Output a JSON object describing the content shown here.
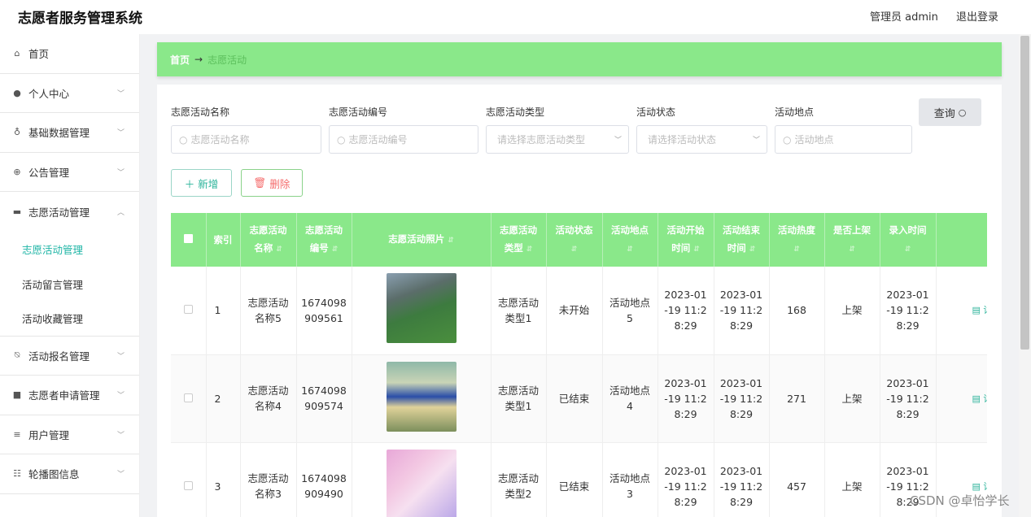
{
  "app": {
    "title": "志愿者服务管理系统",
    "user_label": "管理员 admin",
    "logout": "退出登录"
  },
  "sidebar": {
    "items": [
      {
        "label": "首页",
        "icon": "home-icon"
      },
      {
        "label": "个人中心",
        "icon": "user-icon"
      },
      {
        "label": "基础数据管理",
        "icon": "mic-icon"
      },
      {
        "label": "公告管理",
        "icon": "compass-icon"
      },
      {
        "label": "志愿活动管理",
        "icon": "chat-icon"
      },
      {
        "label": "活动报名管理",
        "icon": "bell-off-icon"
      },
      {
        "label": "志愿者申请管理",
        "icon": "briefcase-icon"
      },
      {
        "label": "用户管理",
        "icon": "list-icon"
      },
      {
        "label": "轮播图信息",
        "icon": "sliders-icon"
      }
    ],
    "subitems": [
      "志愿活动管理",
      "活动留言管理",
      "活动收藏管理"
    ]
  },
  "breadcrumb": {
    "home": "首页",
    "current": "志愿活动"
  },
  "filters": {
    "name_label": "志愿活动名称",
    "name_placeholder": "志愿活动名称",
    "code_label": "志愿活动编号",
    "code_placeholder": "志愿活动编号",
    "type_label": "志愿活动类型",
    "type_placeholder": "请选择志愿活动类型",
    "status_label": "活动状态",
    "status_placeholder": "请选择活动状态",
    "place_label": "活动地点",
    "place_placeholder": "活动地点",
    "query": "查询"
  },
  "actions": {
    "add": "新增",
    "delete": "删除"
  },
  "table": {
    "headers": {
      "index": "索引",
      "name_a": "志愿活动",
      "name_b": "名称",
      "code_a": "志愿活动",
      "code_b": "编号",
      "photo": "志愿活动照片",
      "type_a": "志愿活动",
      "type_b": "类型",
      "status": "活动状态",
      "place": "活动地点",
      "start_a": "活动开始",
      "start_b": "时间",
      "end_a": "活动结束",
      "end_b": "时间",
      "heat": "活动热度",
      "onshelf": "是否上架",
      "created": "录入时间"
    },
    "rows": [
      {
        "index": "1",
        "name_a": "志愿活动",
        "name_b": "名称5",
        "code_a": "1674098",
        "code_b": "909561",
        "type_a": "志愿活动",
        "type_b": "类型1",
        "status": "未开始",
        "place_a": "活动地点",
        "place_b": "5",
        "start": [
          "2023-01",
          "-19 11:2",
          "8:29"
        ],
        "end": [
          "2023-01",
          "-19 11:2",
          "8:29"
        ],
        "heat": "168",
        "onshelf": "上架",
        "created": [
          "2023-01",
          "-19 11:2",
          "8:29"
        ],
        "detail": "▤ 详"
      },
      {
        "index": "2",
        "name_a": "志愿活动",
        "name_b": "名称4",
        "code_a": "1674098",
        "code_b": "909574",
        "type_a": "志愿活动",
        "type_b": "类型1",
        "status": "已结束",
        "place_a": "活动地点",
        "place_b": "4",
        "start": [
          "2023-01",
          "-19 11:2",
          "8:29"
        ],
        "end": [
          "2023-01",
          "-19 11:2",
          "8:29"
        ],
        "heat": "271",
        "onshelf": "上架",
        "created": [
          "2023-01",
          "-19 11:2",
          "8:29"
        ],
        "detail": "▤ 详"
      },
      {
        "index": "3",
        "name_a": "志愿活动",
        "name_b": "名称3",
        "code_a": "1674098",
        "code_b": "909490",
        "type_a": "志愿活动",
        "type_b": "类型2",
        "status": "已结束",
        "place_a": "活动地点",
        "place_b": "3",
        "start": [
          "2023-01",
          "-19 11:2",
          "8:29"
        ],
        "end": [
          "2023-01",
          "-19 11:2",
          "8:29"
        ],
        "heat": "457",
        "onshelf": "上架",
        "created": [
          "2023-01",
          "-19 11:2",
          "8:29"
        ],
        "detail": "▤ 详"
      }
    ]
  },
  "watermark": "CSDN @卓怡学长",
  "colors": {
    "accent": "#8ae88a",
    "teal": "#2bb39a",
    "danger": "#f56c6c"
  }
}
